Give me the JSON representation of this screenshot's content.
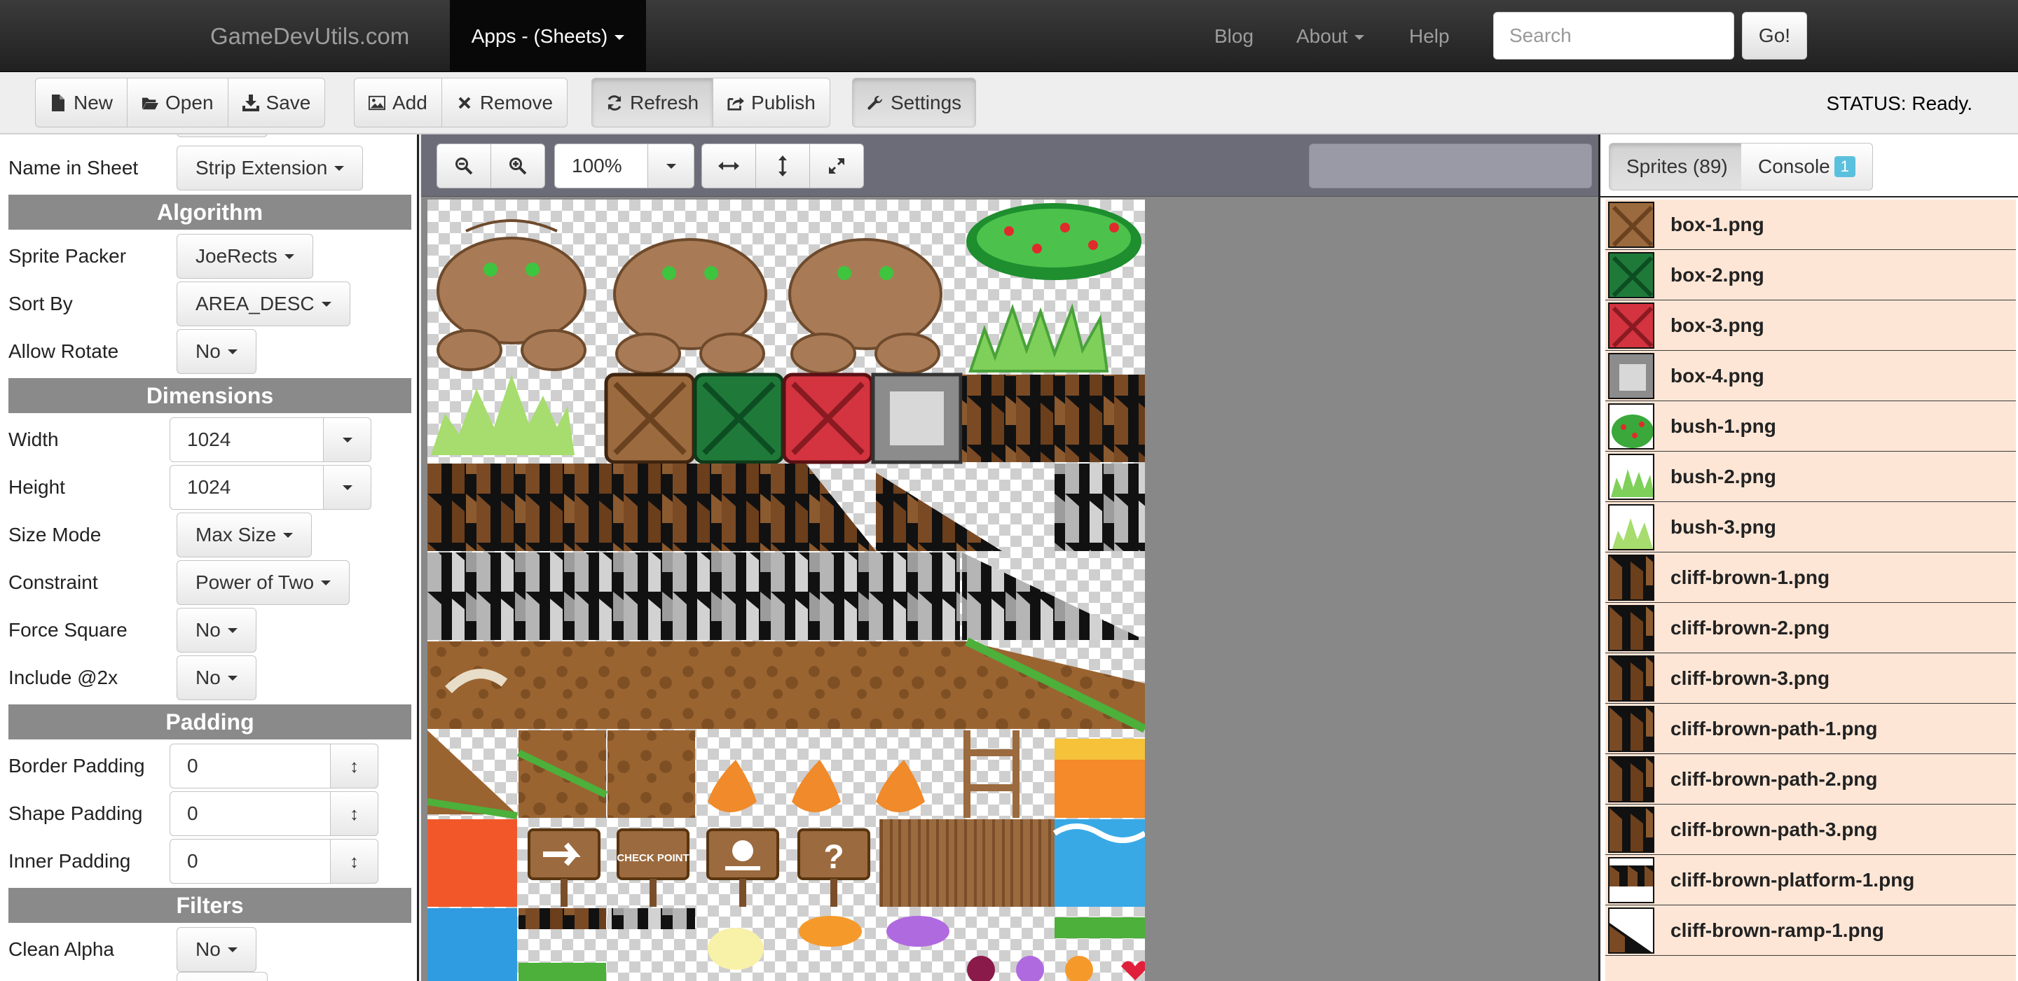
{
  "navbar": {
    "brand": "GameDevUtils.com",
    "apps_menu": "Apps - (Sheets)",
    "links": [
      {
        "label": "Blog",
        "has_caret": false
      },
      {
        "label": "About",
        "has_caret": true
      },
      {
        "label": "Help",
        "has_caret": false
      }
    ],
    "search_placeholder": "Search",
    "go_label": "Go!"
  },
  "toolbar": {
    "new_label": "New",
    "open_label": "Open",
    "save_label": "Save",
    "add_label": "Add",
    "remove_label": "Remove",
    "refresh_label": "Refresh",
    "publish_label": "Publish",
    "settings_label": "Settings",
    "status": "STATUS: Ready."
  },
  "settings": {
    "name_in_sheet": {
      "label": "Name in Sheet",
      "value": "Strip Extension"
    },
    "algorithm": {
      "header": "Algorithm",
      "sprite_packer": {
        "label": "Sprite Packer",
        "value": "JoeRects"
      },
      "sort_by": {
        "label": "Sort By",
        "value": "AREA_DESC"
      },
      "allow_rotate": {
        "label": "Allow Rotate",
        "value": "No"
      }
    },
    "dimensions": {
      "header": "Dimensions",
      "width": {
        "label": "Width",
        "value": "1024"
      },
      "height": {
        "label": "Height",
        "value": "1024"
      },
      "size_mode": {
        "label": "Size Mode",
        "value": "Max Size"
      },
      "constraint": {
        "label": "Constraint",
        "value": "Power of Two"
      },
      "force_square": {
        "label": "Force Square",
        "value": "No"
      },
      "include_2x": {
        "label": "Include @2x",
        "value": "No"
      }
    },
    "padding": {
      "header": "Padding",
      "border_padding": {
        "label": "Border Padding",
        "value": "0"
      },
      "shape_padding": {
        "label": "Shape Padding",
        "value": "0"
      },
      "inner_padding": {
        "label": "Inner Padding",
        "value": "0"
      }
    },
    "filters": {
      "header": "Filters",
      "clean_alpha": {
        "label": "Clean Alpha",
        "value": "No"
      }
    }
  },
  "canvas": {
    "zoom": "100%",
    "sheet_signs": {
      "check_point": "CHECK POINT",
      "question": "?"
    }
  },
  "right_panel": {
    "sprites_tab": "Sprites (89)",
    "console_tab": "Console",
    "console_badge": "1",
    "sprites": [
      {
        "name": "box-1.png",
        "thumb": "box-brown"
      },
      {
        "name": "box-2.png",
        "thumb": "box-green"
      },
      {
        "name": "box-3.png",
        "thumb": "box-red"
      },
      {
        "name": "box-4.png",
        "thumb": "box-steel"
      },
      {
        "name": "bush-1.png",
        "thumb": "bush-berries"
      },
      {
        "name": "bush-2.png",
        "thumb": "bush-grass"
      },
      {
        "name": "bush-3.png",
        "thumb": "bush-light"
      },
      {
        "name": "cliff-brown-1.png",
        "thumb": "cliff"
      },
      {
        "name": "cliff-brown-2.png",
        "thumb": "cliff"
      },
      {
        "name": "cliff-brown-3.png",
        "thumb": "cliff"
      },
      {
        "name": "cliff-brown-path-1.png",
        "thumb": "cliff"
      },
      {
        "name": "cliff-brown-path-2.png",
        "thumb": "cliff"
      },
      {
        "name": "cliff-brown-path-3.png",
        "thumb": "cliff"
      },
      {
        "name": "cliff-brown-platform-1.png",
        "thumb": "cliff-platform"
      },
      {
        "name": "cliff-brown-ramp-1.png",
        "thumb": "cliff-ramp"
      }
    ]
  },
  "colors": {
    "navbar_bg": "#222222",
    "section_header": "#8a8a8a",
    "sprite_row_bg": "#fde6d6",
    "canvas_bg": "#888888",
    "badge": "#5bc0de"
  }
}
